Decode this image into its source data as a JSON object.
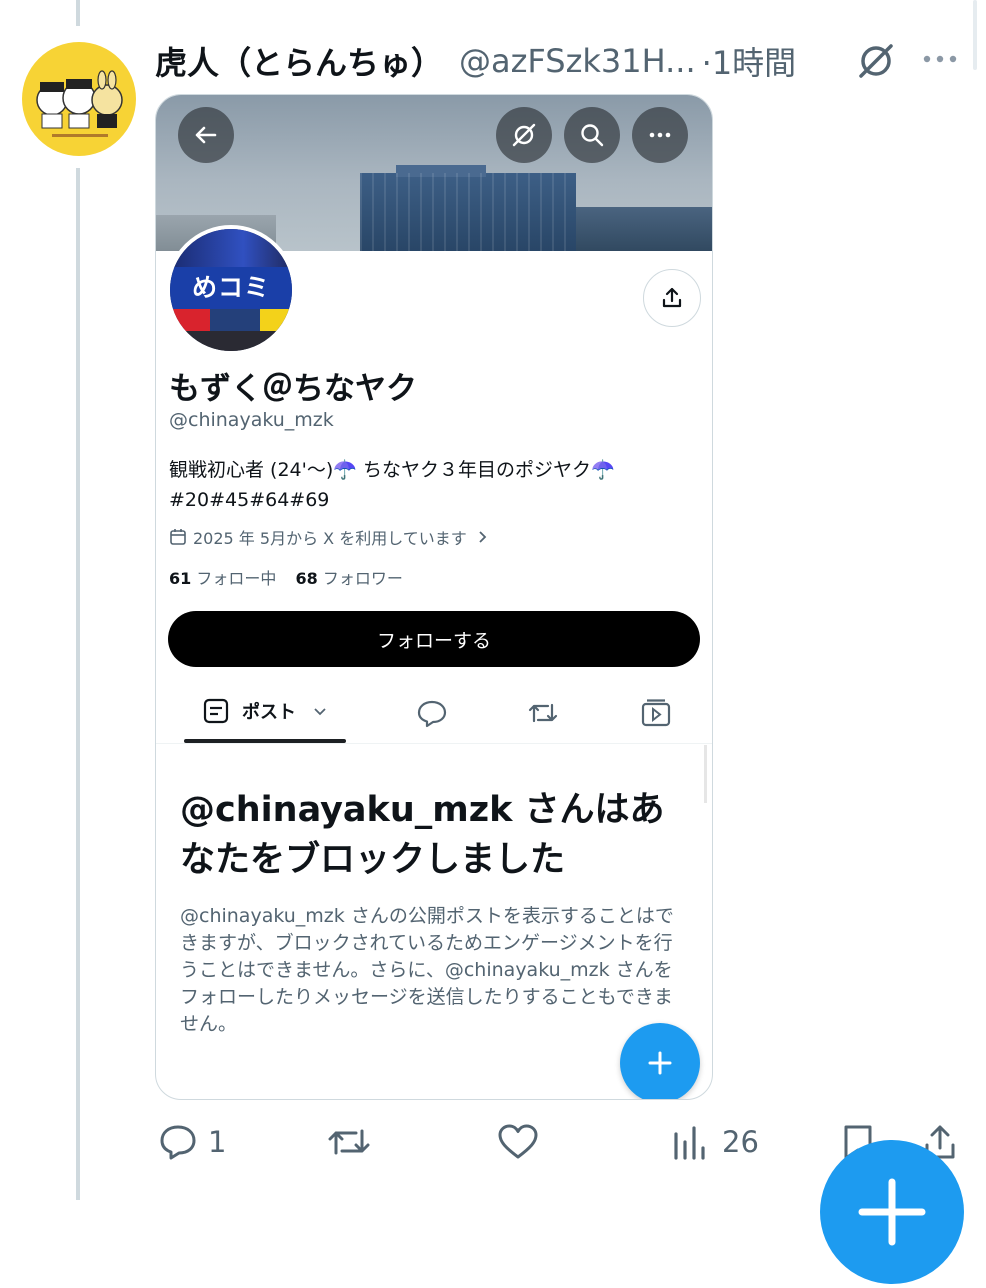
{
  "tweet": {
    "display_name": "虎人（とらんちゅ）",
    "handle": "@azFSzk31H...",
    "time": "·1時間",
    "avatar_brand_color": "#f7d335"
  },
  "screenshot": {
    "profile": {
      "name": "もずく＠ちなヤク",
      "handle": "@chinayaku_mzk",
      "bio_line1": "観戦初心者 (24'〜)☂️ ちなヤク３年目のポジヤク☂️",
      "bio_line2": "#20#45#64#69",
      "joined": "2025 年 5月から X を利用しています",
      "following_count": "61",
      "following_label": "フォロー中",
      "followers_count": "68",
      "followers_label": "フォロワー",
      "follow_button": "フォローする",
      "banner_sign": "めコミ"
    },
    "tabs": [
      {
        "label": "ポスト",
        "icon": "posts-icon"
      },
      {
        "label": "",
        "icon": "reply-icon"
      },
      {
        "label": "",
        "icon": "repost-icon"
      },
      {
        "label": "",
        "icon": "media-icon"
      }
    ],
    "blocked": {
      "title": "@chinayaku_mzk さんはあなたをブロックしました",
      "description": "@chinayaku_mzk さんの公開ポストを表示することはできますが、ブロックされているためエンゲージメントを行うことはできません。さらに、@chinayaku_mzk さんをフォローしたりメッセージを送信したりすることもできません。"
    }
  },
  "actions": {
    "replies": "1",
    "views": "26"
  },
  "colors": {
    "accent": "#1d9bf0",
    "text_secondary": "#536471",
    "text_primary": "#0f1419"
  }
}
